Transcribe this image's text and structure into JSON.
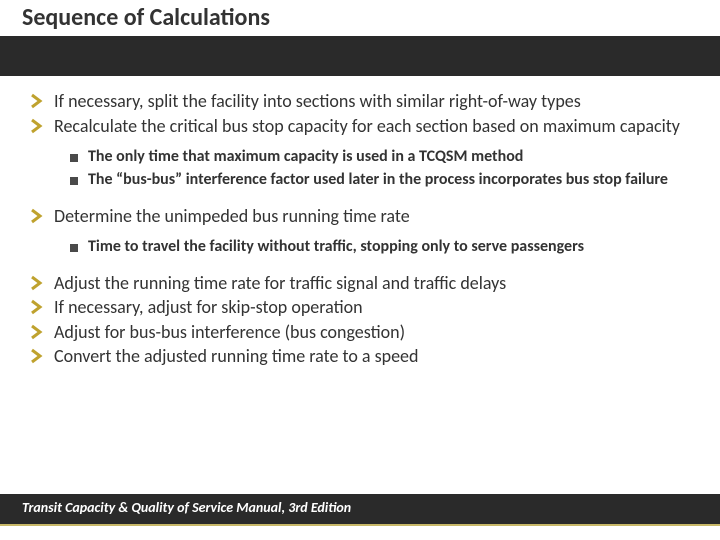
{
  "title": "Sequence of Calculations",
  "bullets": {
    "b1": "If necessary, split the facility into sections with similar right-of-way types",
    "b2": "Recalculate the critical bus stop capacity for each section based on maximum capacity",
    "b2a": "The only time that maximum capacity is used in a TCQSM method",
    "b2b": "The “bus-bus” interference factor used later in the process incorporates bus stop failure",
    "b3": "Determine the unimpeded bus running time rate",
    "b3a": "Time to travel the facility without traffic, stopping only to serve passengers",
    "b4": "Adjust the running time rate for traffic signal and traffic delays",
    "b5": "If necessary, adjust for skip-stop operation",
    "b6": "Adjust for bus-bus interference (bus congestion)",
    "b7": "Convert the adjusted running time rate to a speed"
  },
  "footer": "Transit Capacity & Quality of Service Manual, 3rd Edition",
  "colors": {
    "accent": "#bfa22e",
    "dark": "#2a2a2a"
  }
}
